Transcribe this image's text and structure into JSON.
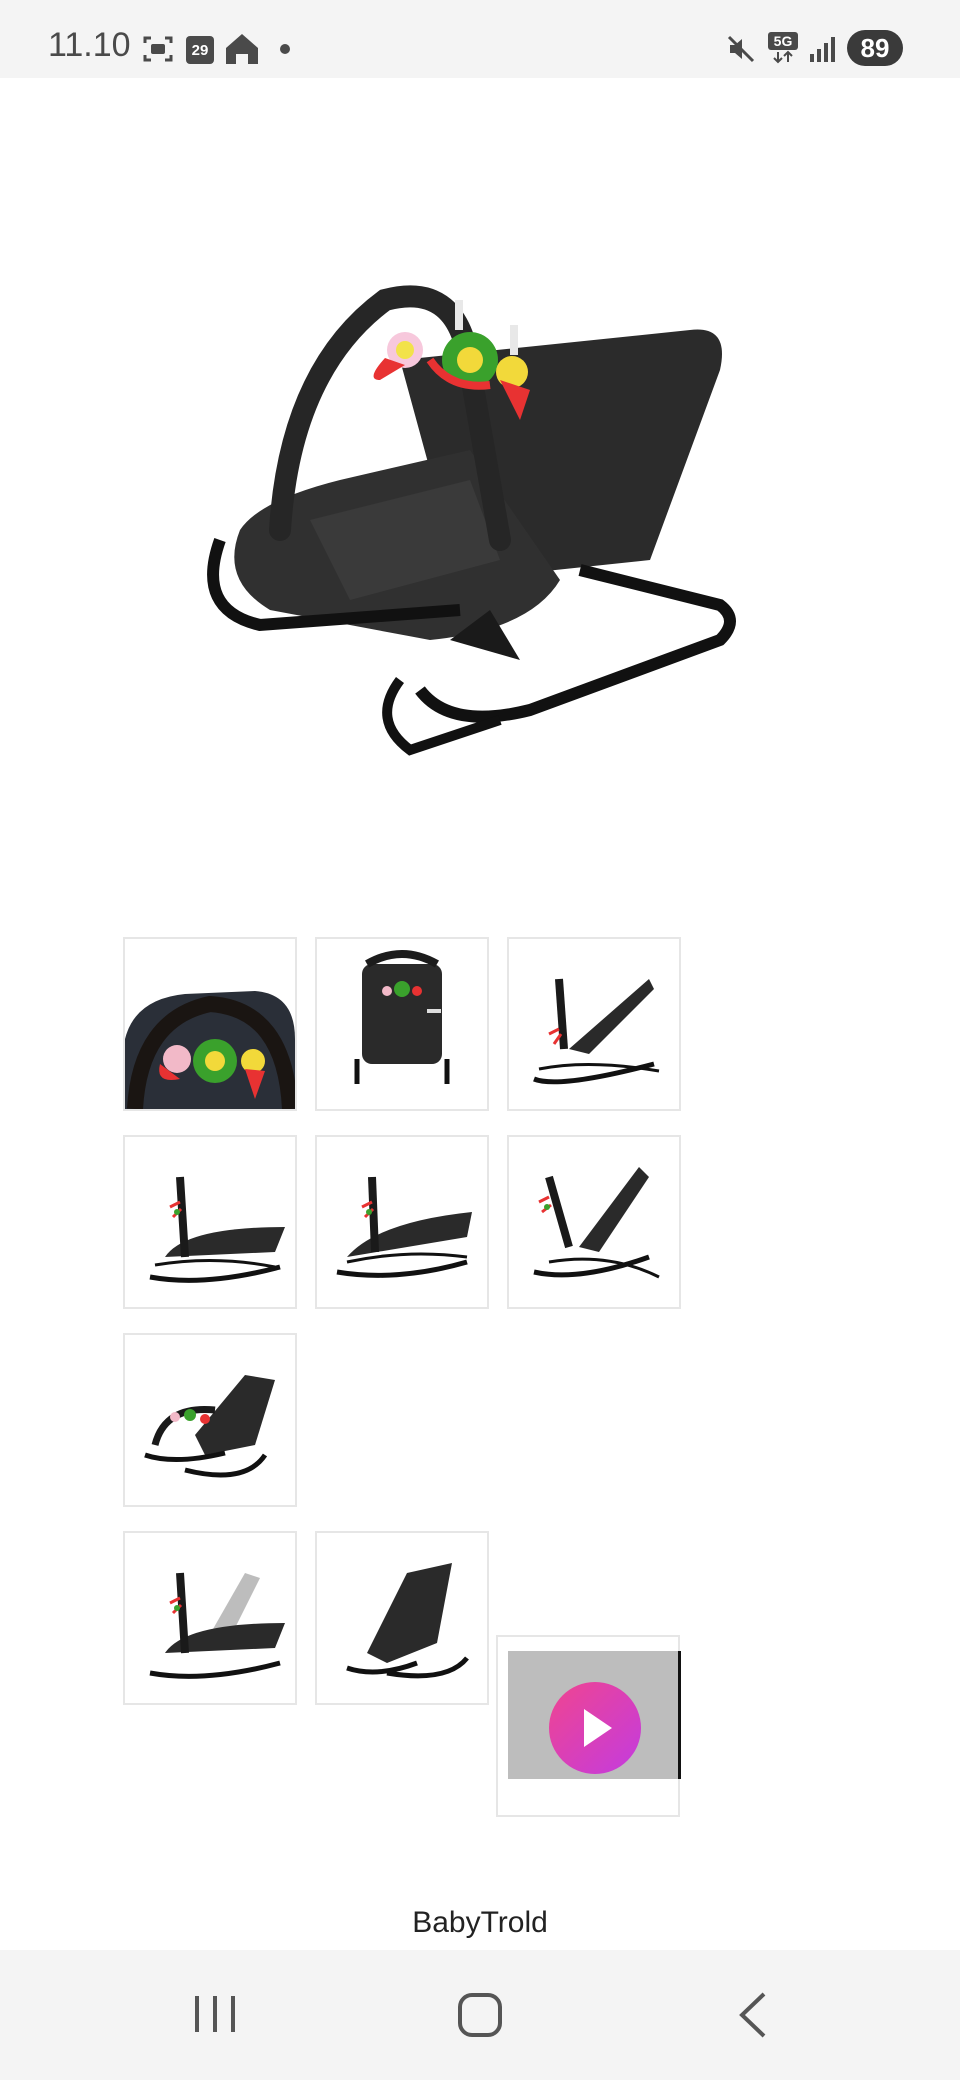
{
  "status_bar": {
    "time": "11.10",
    "calendar_day": "29",
    "network": "5G",
    "battery": "89",
    "icons": [
      "screenshot-icon",
      "calendar-icon",
      "home-app-icon",
      "dot-icon",
      "mute-icon",
      "5g-icon",
      "signal-icon",
      "battery-icon"
    ]
  },
  "gallery": {
    "main_image": "baby-bouncer-main-image",
    "thumbnails": [
      {
        "name": "thumb-toys-closeup"
      },
      {
        "name": "thumb-front-view"
      },
      {
        "name": "thumb-side-upright"
      },
      {
        "name": "thumb-side-flat-1"
      },
      {
        "name": "thumb-side-flat-2"
      },
      {
        "name": "thumb-side-reclined"
      },
      {
        "name": "thumb-angle-with-toys"
      },
      {
        "name": "thumb-adjust-positions"
      },
      {
        "name": "thumb-without-bar"
      }
    ],
    "video": {
      "icon": "play-icon"
    }
  },
  "footer": {
    "brand": "BabyTrold"
  },
  "nav_bar": {
    "icons": [
      "recents-icon",
      "home-icon",
      "back-icon"
    ]
  }
}
